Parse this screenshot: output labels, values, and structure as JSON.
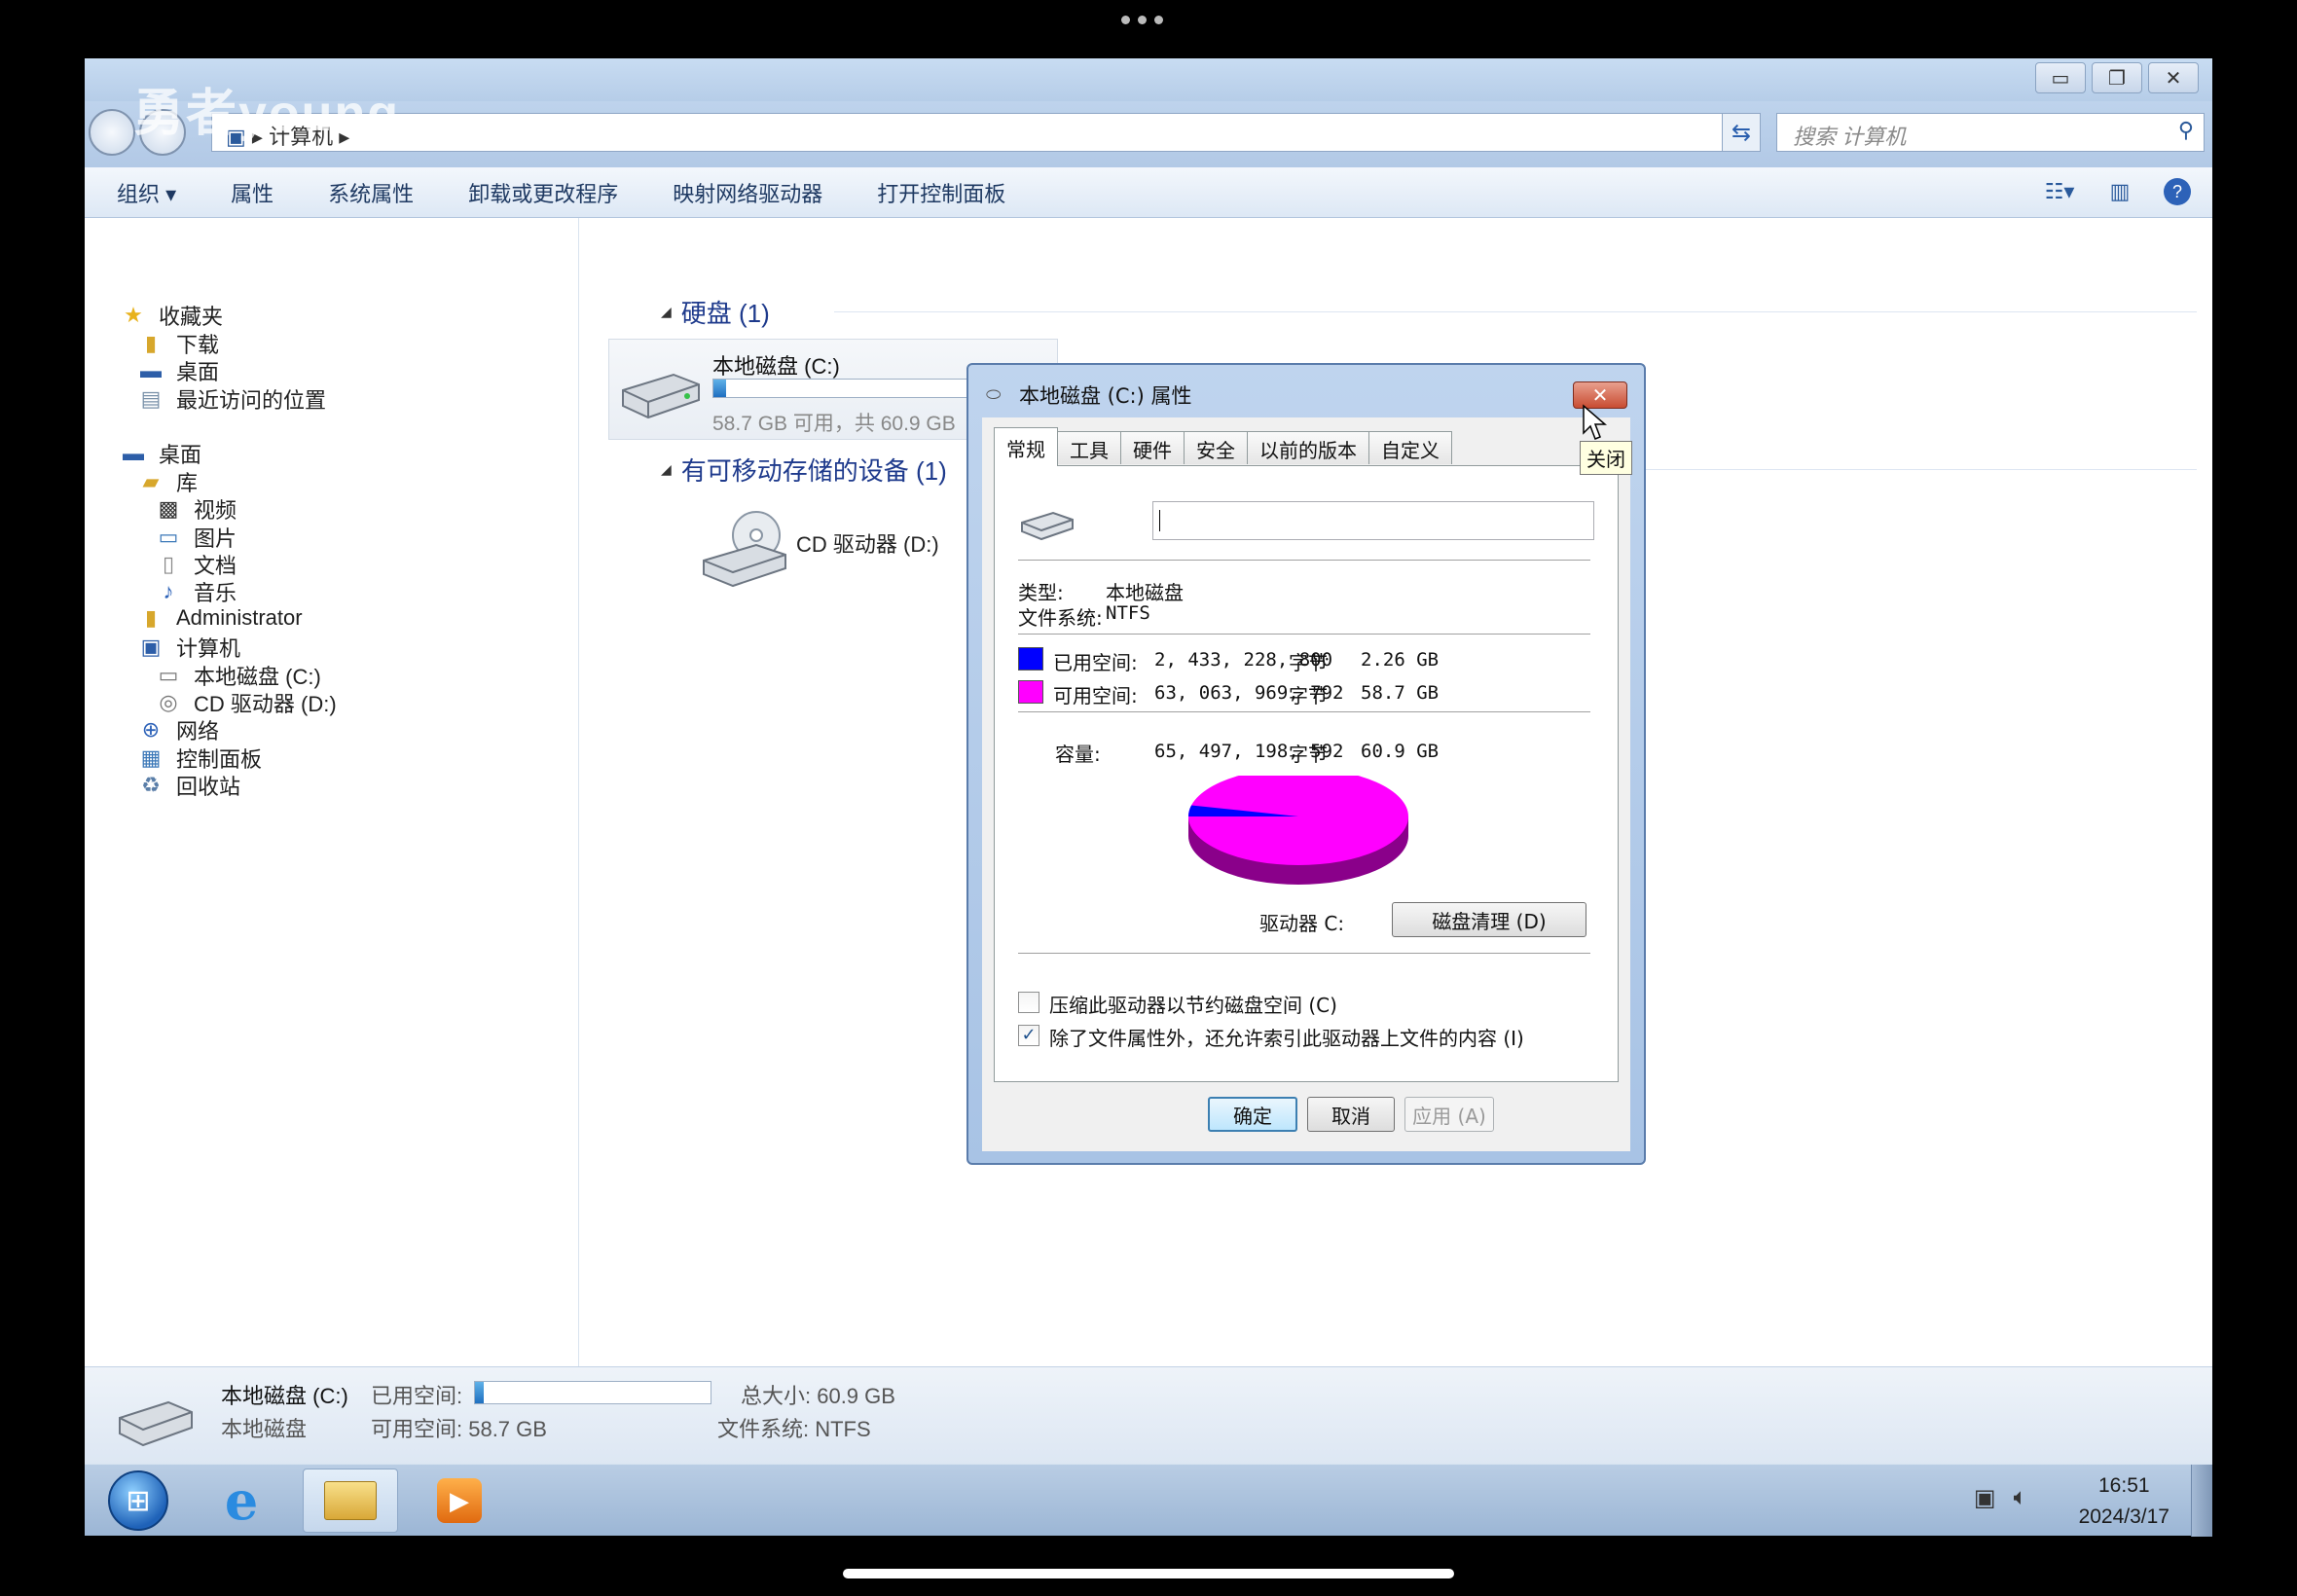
{
  "watermark": "勇者young",
  "window": {
    "address_path": "▸ 计算机 ▸",
    "search_placeholder": "搜索 计算机",
    "toolbar": [
      "组织 ▾",
      "属性",
      "系统属性",
      "卸载或更改程序",
      "映射网络驱动器",
      "打开控制面板"
    ]
  },
  "sidebar": {
    "favorites": "收藏夹",
    "downloads": "下载",
    "desktop_fav": "桌面",
    "recent": "最近访问的位置",
    "desktop": "桌面",
    "libraries": "库",
    "videos": "视频",
    "pictures": "图片",
    "documents": "文档",
    "music": "音乐",
    "admin": "Administrator",
    "computer": "计算机",
    "local_c": "本地磁盘 (C:)",
    "cd_d": "CD 驱动器 (D:)",
    "network": "网络",
    "control_panel": "控制面板",
    "recycle": "回收站"
  },
  "content": {
    "hdd_group": "硬盘 (1)",
    "removable_group": "有可移动存储的设备 (1)",
    "c_name": "本地磁盘 (C:)",
    "c_free": "58.7 GB 可用，共 60.9 GB",
    "c_used_fraction": 0.037,
    "d_name": "CD 驱动器 (D:)"
  },
  "details": {
    "name": "本地磁盘 (C:)",
    "type": "本地磁盘",
    "used_label": "已用空间:",
    "free_label": "可用空间: 58.7 GB",
    "total": "总大小: 60.9 GB",
    "fs": "文件系统: NTFS"
  },
  "clock": {
    "time": "16:51",
    "date": "2024/3/17"
  },
  "dialog": {
    "title": "本地磁盘 (C:) 属性",
    "close": "✕",
    "tooltip": "关闭",
    "tabs": [
      "常规",
      "工具",
      "硬件",
      "安全",
      "以前的版本",
      "自定义"
    ],
    "type_label": "类型:",
    "type_value": "本地磁盘",
    "fs_label": "文件系统:",
    "fs_value": "NTFS",
    "used_label": "已用空间:",
    "used_bytes": "2, 433, 228, 800",
    "used_unit": "字节",
    "used_gb": "2.26 GB",
    "free_label": "可用空间:",
    "free_bytes": "63, 063, 969, 792",
    "free_unit": "字节",
    "free_gb": "58.7 GB",
    "cap_label": "容量:",
    "cap_bytes": "65, 497, 198, 592",
    "cap_unit": "字节",
    "cap_gb": "60.9 GB",
    "drive_label": "驱动器 C:",
    "cleanup": "磁盘清理 (D)",
    "compress": "压缩此驱动器以节约磁盘空间 (C)",
    "index": "除了文件属性外，还允许索引此驱动器上文件的内容 (I)",
    "ok": "确定",
    "cancel": "取消",
    "apply": "应用 (A)",
    "used_color": "#0000ff",
    "free_color": "#ff00ff"
  }
}
